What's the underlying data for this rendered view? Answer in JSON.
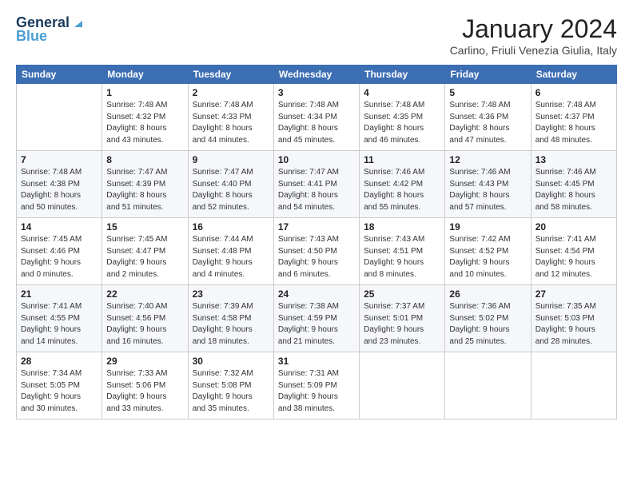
{
  "logo": {
    "line1": "General",
    "line2": "Blue"
  },
  "header": {
    "title": "January 2024",
    "location": "Carlino, Friuli Venezia Giulia, Italy"
  },
  "weekdays": [
    "Sunday",
    "Monday",
    "Tuesday",
    "Wednesday",
    "Thursday",
    "Friday",
    "Saturday"
  ],
  "weeks": [
    [
      {
        "day": "",
        "info": ""
      },
      {
        "day": "1",
        "info": "Sunrise: 7:48 AM\nSunset: 4:32 PM\nDaylight: 8 hours\nand 43 minutes."
      },
      {
        "day": "2",
        "info": "Sunrise: 7:48 AM\nSunset: 4:33 PM\nDaylight: 8 hours\nand 44 minutes."
      },
      {
        "day": "3",
        "info": "Sunrise: 7:48 AM\nSunset: 4:34 PM\nDaylight: 8 hours\nand 45 minutes."
      },
      {
        "day": "4",
        "info": "Sunrise: 7:48 AM\nSunset: 4:35 PM\nDaylight: 8 hours\nand 46 minutes."
      },
      {
        "day": "5",
        "info": "Sunrise: 7:48 AM\nSunset: 4:36 PM\nDaylight: 8 hours\nand 47 minutes."
      },
      {
        "day": "6",
        "info": "Sunrise: 7:48 AM\nSunset: 4:37 PM\nDaylight: 8 hours\nand 48 minutes."
      }
    ],
    [
      {
        "day": "7",
        "info": "Sunrise: 7:48 AM\nSunset: 4:38 PM\nDaylight: 8 hours\nand 50 minutes."
      },
      {
        "day": "8",
        "info": "Sunrise: 7:47 AM\nSunset: 4:39 PM\nDaylight: 8 hours\nand 51 minutes."
      },
      {
        "day": "9",
        "info": "Sunrise: 7:47 AM\nSunset: 4:40 PM\nDaylight: 8 hours\nand 52 minutes."
      },
      {
        "day": "10",
        "info": "Sunrise: 7:47 AM\nSunset: 4:41 PM\nDaylight: 8 hours\nand 54 minutes."
      },
      {
        "day": "11",
        "info": "Sunrise: 7:46 AM\nSunset: 4:42 PM\nDaylight: 8 hours\nand 55 minutes."
      },
      {
        "day": "12",
        "info": "Sunrise: 7:46 AM\nSunset: 4:43 PM\nDaylight: 8 hours\nand 57 minutes."
      },
      {
        "day": "13",
        "info": "Sunrise: 7:46 AM\nSunset: 4:45 PM\nDaylight: 8 hours\nand 58 minutes."
      }
    ],
    [
      {
        "day": "14",
        "info": "Sunrise: 7:45 AM\nSunset: 4:46 PM\nDaylight: 9 hours\nand 0 minutes."
      },
      {
        "day": "15",
        "info": "Sunrise: 7:45 AM\nSunset: 4:47 PM\nDaylight: 9 hours\nand 2 minutes."
      },
      {
        "day": "16",
        "info": "Sunrise: 7:44 AM\nSunset: 4:48 PM\nDaylight: 9 hours\nand 4 minutes."
      },
      {
        "day": "17",
        "info": "Sunrise: 7:43 AM\nSunset: 4:50 PM\nDaylight: 9 hours\nand 6 minutes."
      },
      {
        "day": "18",
        "info": "Sunrise: 7:43 AM\nSunset: 4:51 PM\nDaylight: 9 hours\nand 8 minutes."
      },
      {
        "day": "19",
        "info": "Sunrise: 7:42 AM\nSunset: 4:52 PM\nDaylight: 9 hours\nand 10 minutes."
      },
      {
        "day": "20",
        "info": "Sunrise: 7:41 AM\nSunset: 4:54 PM\nDaylight: 9 hours\nand 12 minutes."
      }
    ],
    [
      {
        "day": "21",
        "info": "Sunrise: 7:41 AM\nSunset: 4:55 PM\nDaylight: 9 hours\nand 14 minutes."
      },
      {
        "day": "22",
        "info": "Sunrise: 7:40 AM\nSunset: 4:56 PM\nDaylight: 9 hours\nand 16 minutes."
      },
      {
        "day": "23",
        "info": "Sunrise: 7:39 AM\nSunset: 4:58 PM\nDaylight: 9 hours\nand 18 minutes."
      },
      {
        "day": "24",
        "info": "Sunrise: 7:38 AM\nSunset: 4:59 PM\nDaylight: 9 hours\nand 21 minutes."
      },
      {
        "day": "25",
        "info": "Sunrise: 7:37 AM\nSunset: 5:01 PM\nDaylight: 9 hours\nand 23 minutes."
      },
      {
        "day": "26",
        "info": "Sunrise: 7:36 AM\nSunset: 5:02 PM\nDaylight: 9 hours\nand 25 minutes."
      },
      {
        "day": "27",
        "info": "Sunrise: 7:35 AM\nSunset: 5:03 PM\nDaylight: 9 hours\nand 28 minutes."
      }
    ],
    [
      {
        "day": "28",
        "info": "Sunrise: 7:34 AM\nSunset: 5:05 PM\nDaylight: 9 hours\nand 30 minutes."
      },
      {
        "day": "29",
        "info": "Sunrise: 7:33 AM\nSunset: 5:06 PM\nDaylight: 9 hours\nand 33 minutes."
      },
      {
        "day": "30",
        "info": "Sunrise: 7:32 AM\nSunset: 5:08 PM\nDaylight: 9 hours\nand 35 minutes."
      },
      {
        "day": "31",
        "info": "Sunrise: 7:31 AM\nSunset: 5:09 PM\nDaylight: 9 hours\nand 38 minutes."
      },
      {
        "day": "",
        "info": ""
      },
      {
        "day": "",
        "info": ""
      },
      {
        "day": "",
        "info": ""
      }
    ]
  ]
}
